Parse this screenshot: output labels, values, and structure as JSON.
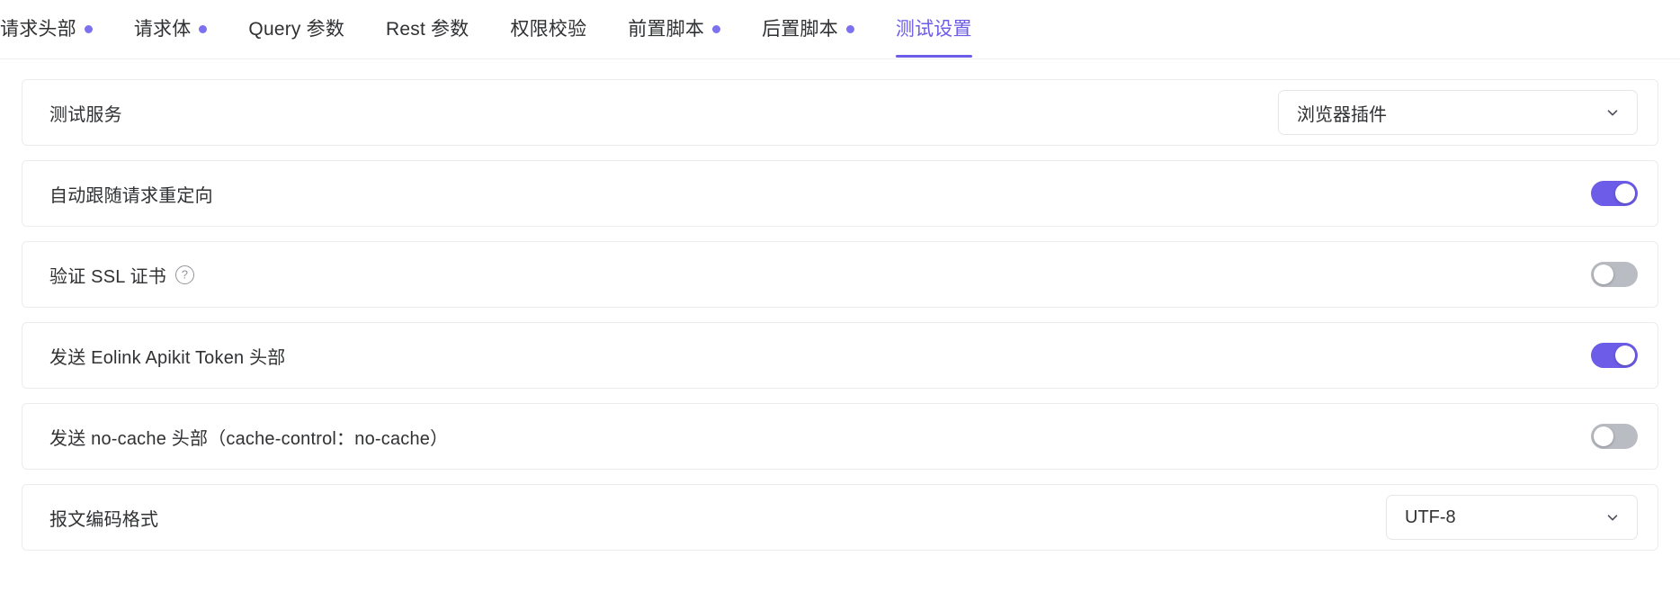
{
  "tabs": [
    {
      "label": "请求头部",
      "dot": true,
      "active": false
    },
    {
      "label": "请求体",
      "dot": true,
      "active": false
    },
    {
      "label": "Query 参数",
      "dot": false,
      "active": false
    },
    {
      "label": "Rest 参数",
      "dot": false,
      "active": false
    },
    {
      "label": "权限校验",
      "dot": false,
      "active": false
    },
    {
      "label": "前置脚本",
      "dot": true,
      "active": false
    },
    {
      "label": "后置脚本",
      "dot": true,
      "active": false
    },
    {
      "label": "测试设置",
      "dot": false,
      "active": true
    }
  ],
  "colors": {
    "accent": "#6c5ce7",
    "dot": "#7c72f0",
    "switch_on": "#6c5ce7",
    "switch_off": "#b9bcc2",
    "border": "#ececee",
    "text": "#303133"
  },
  "settings": {
    "rows": [
      {
        "label": "测试服务",
        "control": "select",
        "value": "浏览器插件",
        "icon": "chevron-down-icon",
        "name": "test-service"
      },
      {
        "label": "自动跟随请求重定向",
        "control": "switch",
        "state": "on",
        "name": "auto-follow-redirect"
      },
      {
        "label": "验证 SSL 证书",
        "control": "switch",
        "state": "off",
        "help": "?",
        "help_icon": "question-circle-icon",
        "name": "verify-ssl-certificate"
      },
      {
        "label": "发送 Eolink Apikit Token 头部",
        "control": "switch",
        "state": "on",
        "name": "send-eolink-apikit-token-header"
      },
      {
        "label": "发送 no-cache 头部（cache-control：no-cache）",
        "control": "switch",
        "state": "off",
        "name": "send-no-cache-header"
      },
      {
        "label": "报文编码格式",
        "control": "select",
        "value": "UTF-8",
        "icon": "chevron-down-icon",
        "name": "message-encoding-format"
      }
    ]
  }
}
